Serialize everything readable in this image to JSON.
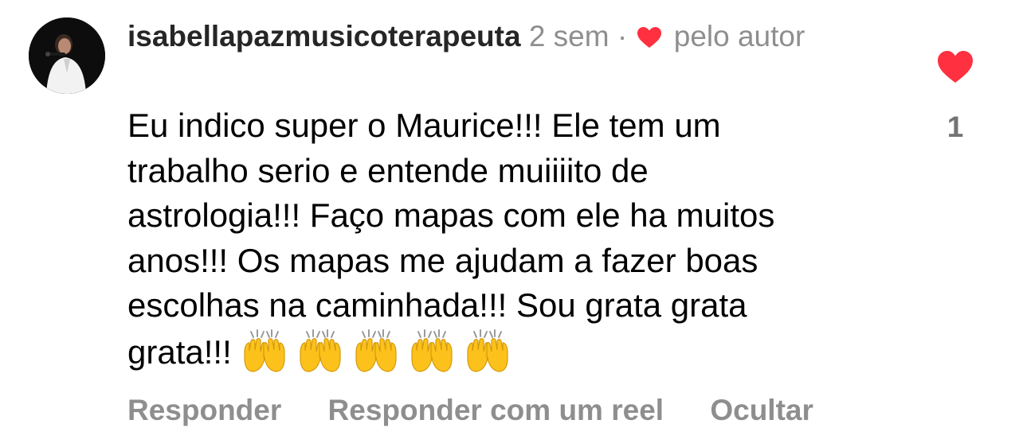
{
  "comment": {
    "username": "isabellapazmusicoterapeuta",
    "time": "2 sem",
    "separator": "·",
    "liked_by_author_label": "pelo autor",
    "body_lines": [
      "Eu indico super o Maurice!!! Ele tem um",
      "trabalho serio e entende muiiiito de",
      "astrologia!!! Faço mapas com ele ha muitos",
      "anos!!! Os mapas me ajudam a fazer boas",
      "escolhas na caminhada!!! Sou grata grata",
      "grata!!!"
    ],
    "emojis": [
      "raising-hands-emoji",
      "raising-hands-emoji",
      "raising-hands-emoji",
      "raising-hands-emoji",
      "raising-hands-emoji"
    ],
    "like_count": "1"
  },
  "actions": {
    "reply": "Responder",
    "reply_with_reel": "Responder com um reel",
    "hide": "Ocultar"
  },
  "colors": {
    "heart": "#ff3040",
    "muted": "#8e8e8e",
    "username": "#262626",
    "emoji": "#fcc21b"
  }
}
